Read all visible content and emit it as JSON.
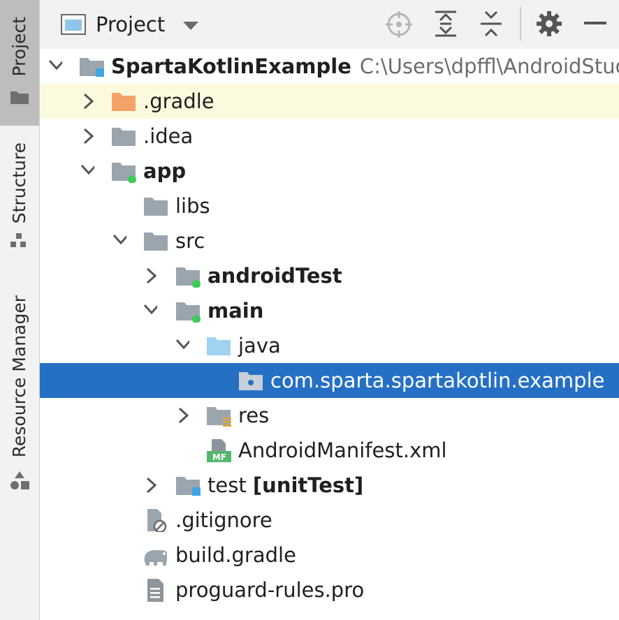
{
  "tool_strip": {
    "tabs": [
      {
        "label": "Project",
        "icon": "folder-icon",
        "active": true
      },
      {
        "label": "Structure",
        "icon": "structure-icon",
        "active": false
      },
      {
        "label": "Resource Manager",
        "icon": "shapes-icon",
        "active": false
      }
    ]
  },
  "toolbar": {
    "view_label": "Project",
    "icons": [
      "locate-icon",
      "expand-all-icon",
      "collapse-all-icon",
      "gear-icon",
      "minimize-icon"
    ]
  },
  "tree": {
    "root": {
      "label": "SpartaKotlinExample",
      "path": "C:\\Users\\dpffl\\AndroidStudi"
    },
    "gradle_dir": ".gradle",
    "idea_dir": ".idea",
    "app": "app",
    "libs": "libs",
    "src": "src",
    "android_test": "androidTest",
    "main": "main",
    "java": "java",
    "package": "com.sparta.spartakotlin.example",
    "res": "res",
    "manifest": "AndroidManifest.xml",
    "manifest_badge": "MF",
    "test": {
      "name": "test",
      "tag": "[unitTest]"
    },
    "gitignore": ".gitignore",
    "build_gradle": "build.gradle",
    "proguard": "proguard-rules.pro"
  },
  "colors": {
    "selection": "#2570c5",
    "highlight_row": "#fcfade",
    "module_dot": "#3ec95a",
    "gradle_folder": "#f4a267",
    "source_folder": "#9fd3ef",
    "root_badge": "#3fa6e0"
  }
}
